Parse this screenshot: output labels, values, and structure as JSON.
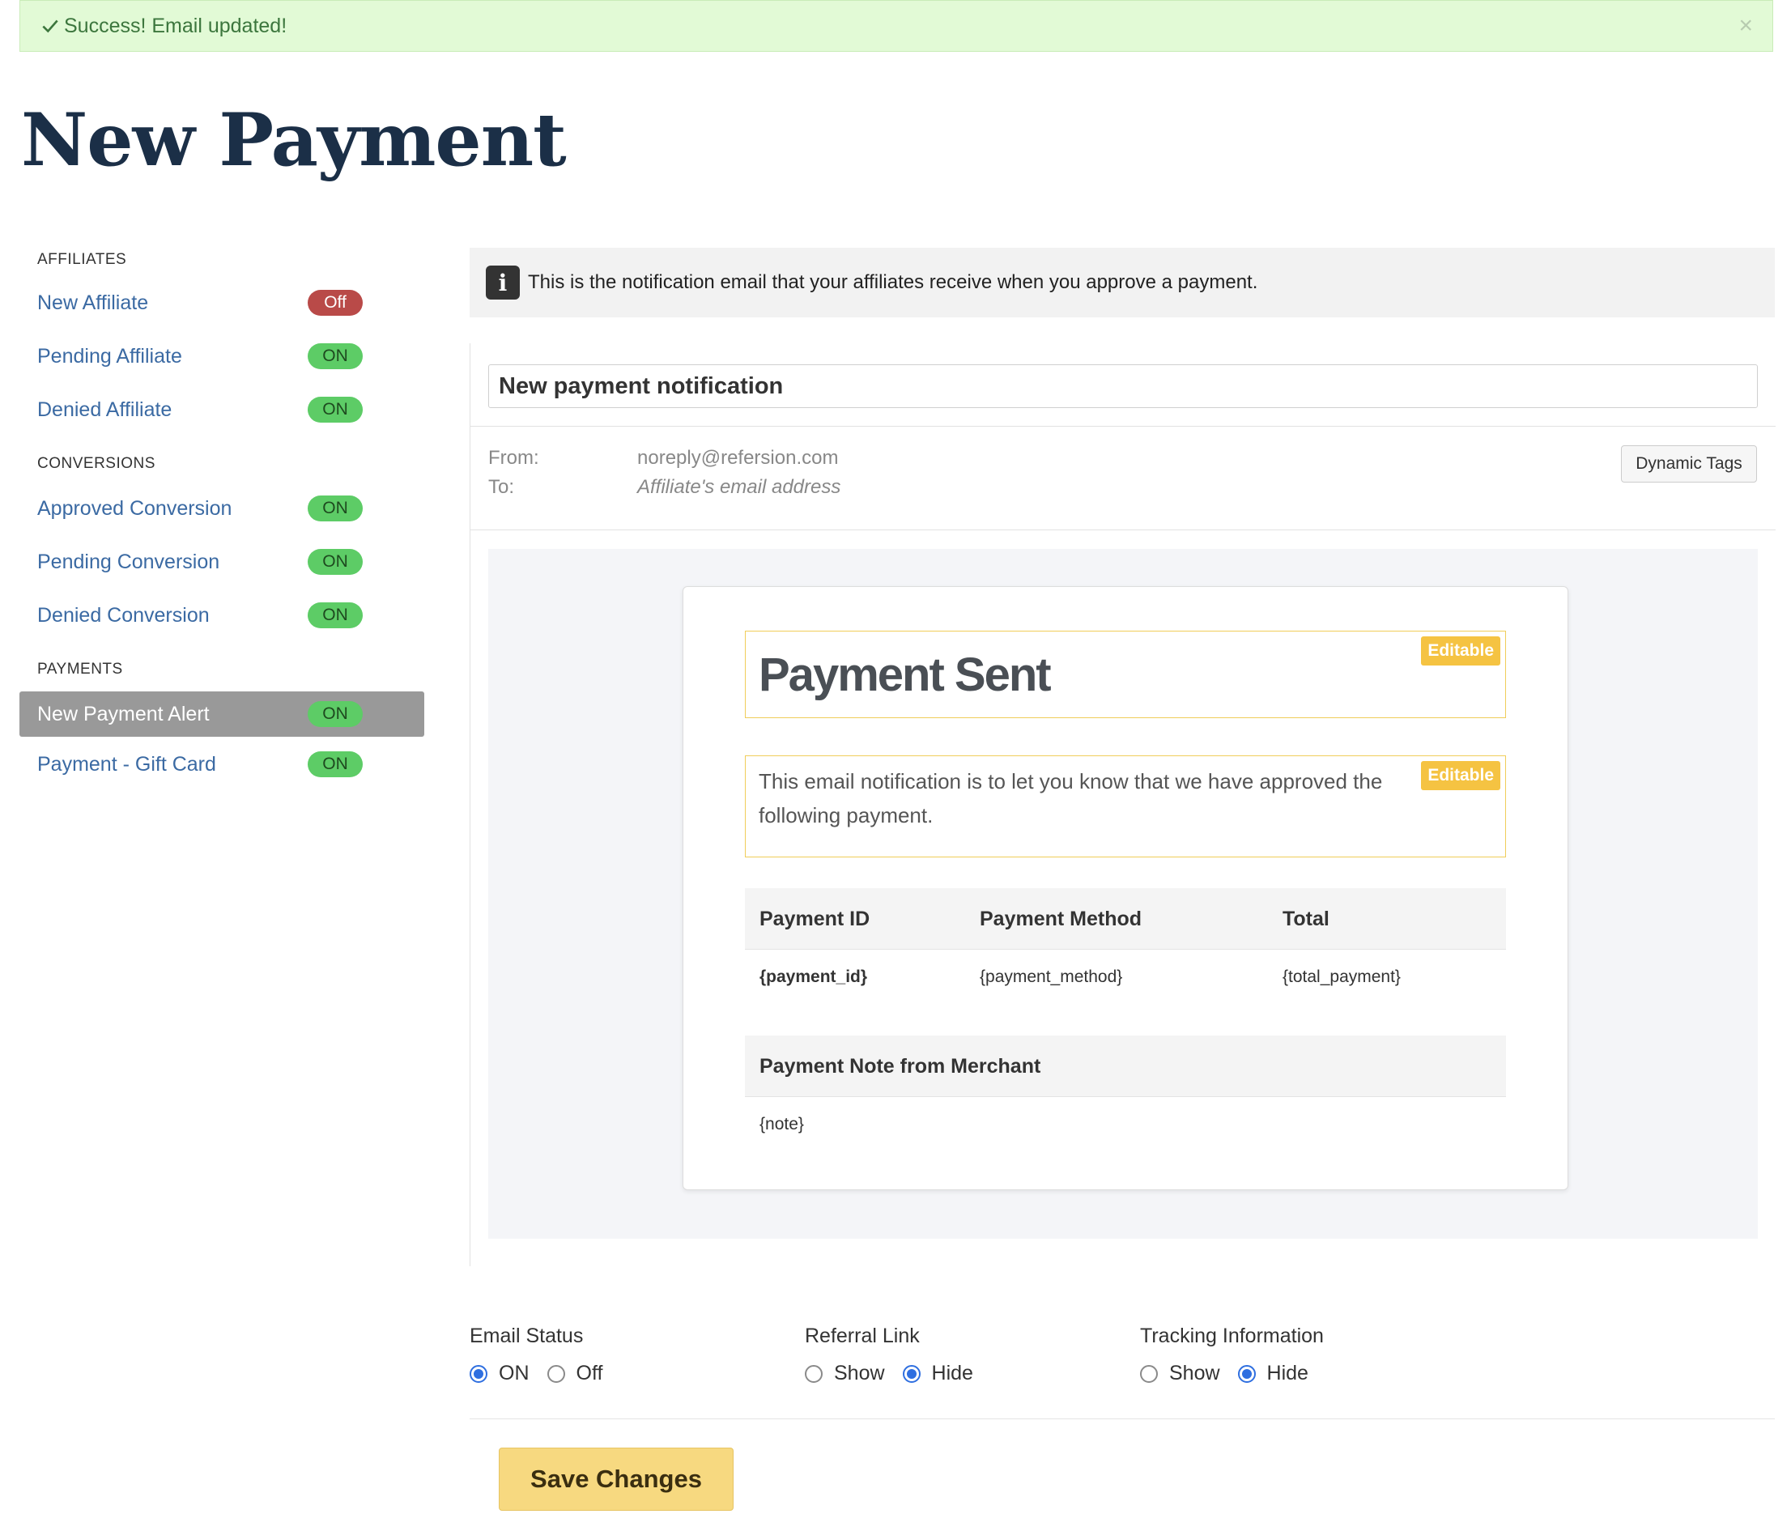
{
  "alert": {
    "message": "Success! Email updated!",
    "close": "×",
    "icon": "check-icon"
  },
  "page": {
    "title": "New Payment"
  },
  "sidebar": {
    "sections": [
      {
        "heading": "AFFILIATES",
        "items": [
          {
            "label": "New Affiliate",
            "status": "Off"
          },
          {
            "label": "Pending Affiliate",
            "status": "ON"
          },
          {
            "label": "Denied Affiliate",
            "status": "ON"
          }
        ]
      },
      {
        "heading": "CONVERSIONS",
        "items": [
          {
            "label": "Approved Conversion",
            "status": "ON"
          },
          {
            "label": "Pending Conversion",
            "status": "ON"
          },
          {
            "label": "Denied Conversion",
            "status": "ON"
          }
        ]
      },
      {
        "heading": "PAYMENTS",
        "items": [
          {
            "label": "New Payment Alert",
            "status": "ON",
            "active": true
          },
          {
            "label": "Payment - Gift Card",
            "status": "ON"
          }
        ]
      }
    ]
  },
  "info": {
    "icon": "info-icon",
    "icon_glyph": "i",
    "text": "This is the notification email that your affiliates receive when you approve a payment."
  },
  "email": {
    "subject": "New payment notification",
    "from_label": "From:",
    "from_value": "noreply@refersion.com",
    "to_label": "To:",
    "to_value": "Affiliate's email address",
    "dynamic_tags_label": "Dynamic Tags",
    "editable_label": "Editable",
    "heading": "Payment Sent",
    "body": "This email notification is to let you know that we have approved the following payment.",
    "table": {
      "headers": [
        "Payment ID",
        "Payment Method",
        "Total"
      ],
      "row": [
        "{payment_id}",
        "{payment_method}",
        "{total_payment}"
      ]
    },
    "note_header": "Payment Note from Merchant",
    "note_value": "{note}"
  },
  "options": {
    "email_status": {
      "title": "Email Status",
      "choices": [
        "ON",
        "Off"
      ],
      "selected": "ON"
    },
    "referral_link": {
      "title": "Referral Link",
      "choices": [
        "Show",
        "Hide"
      ],
      "selected": "Hide"
    },
    "tracking_info": {
      "title": "Tracking Information",
      "choices": [
        "Show",
        "Hide"
      ],
      "selected": "Hide"
    }
  },
  "save_label": "Save Changes",
  "colors": {
    "on_badge": "#5dcc66",
    "off_badge": "#b94a48",
    "link": "#3b6aa3",
    "accent": "#f5c342",
    "title": "#1b2f47"
  }
}
